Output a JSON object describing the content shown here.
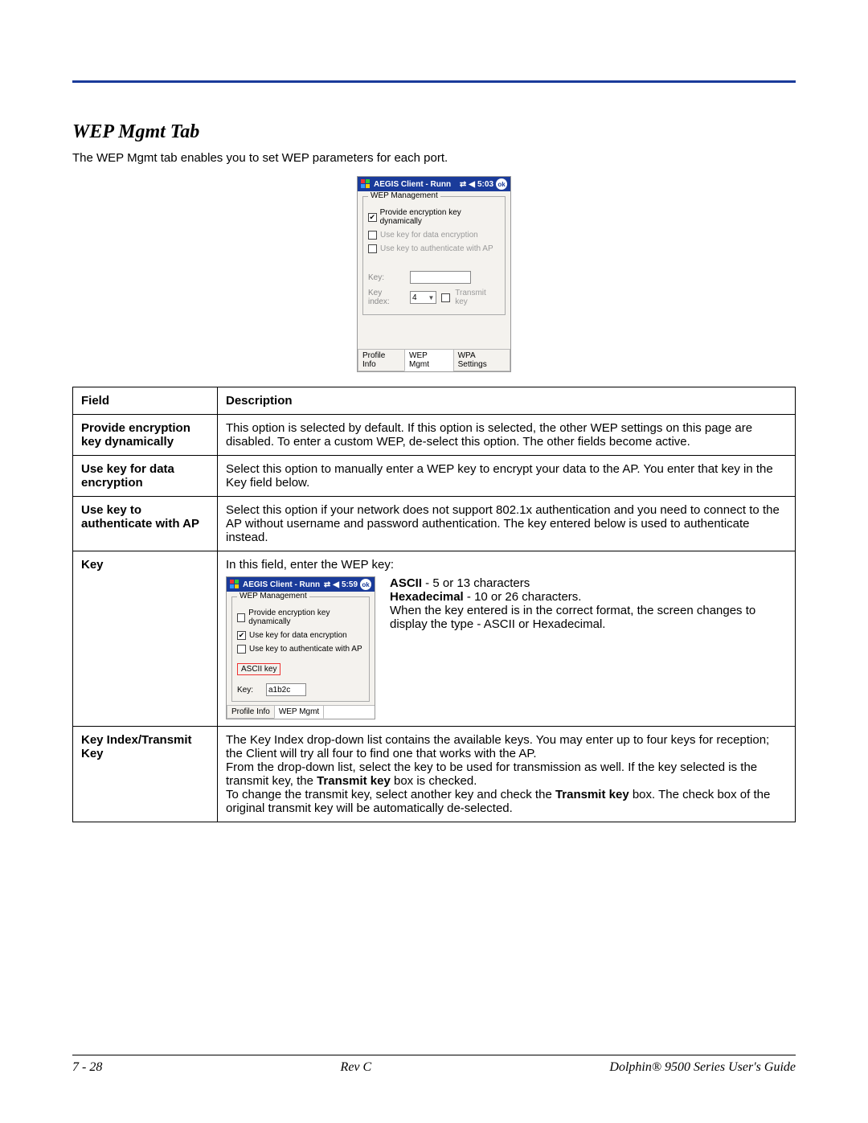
{
  "section_title": "WEP Mgmt Tab",
  "intro": "The WEP Mgmt tab enables you to set WEP parameters for each port.",
  "fig1": {
    "title": "AEGIS Client - Runn",
    "time": "5:03",
    "ok": "ok",
    "group_legend": "WEP Management",
    "chk1": "Provide encryption key dynamically",
    "chk2": "Use key for data encryption",
    "chk3": "Use key to authenticate with AP",
    "key_label": "Key:",
    "keyidx_label": "Key index:",
    "keyidx_value": "4",
    "transmit_label": "Transmit key",
    "tab1": "Profile Info",
    "tab2": "WEP Mgmt",
    "tab3": "WPA Settings"
  },
  "table": {
    "hdr_field": "Field",
    "hdr_desc": "Description",
    "row1_f": "Provide encryption key dynamically",
    "row1_d": "This option is selected by default. If this option is selected, the other WEP settings on this page are disabled. To enter a custom WEP, de-select this option. The other fields become active.",
    "row2_f": "Use key for data encryption",
    "row2_d": "Select this option to manually enter a WEP key to encrypt your data to the AP. You enter that key in the Key field below.",
    "row3_f": "Use key to authenticate with AP",
    "row3_d": "Select this option if your network does not support 802.1x authentication and you need to connect to the AP without username and password authentication. The key entered below is used to authenticate instead.",
    "row4_f": "Key",
    "row4_intro": "In this field, enter the WEP key:",
    "row4_ascii_b": "ASCII",
    "row4_ascii": " - 5 or 13 characters",
    "row4_hex_b": "Hexadecimal",
    "row4_hex": " - 10 or 26 characters.",
    "row4_rest": "When the key entered is in the correct format, the screen changes to display the type - ASCII or Hexadecimal.",
    "row5_f": "Key Index/Transmit Key",
    "row5_p1": "The Key Index drop-down list contains the available keys. You may enter up to four keys for reception; the Client will try all four to find one that works with the AP.",
    "row5_p2a": "From the drop-down list, select the key to be used for transmission as well. If the key selected is the transmit key, the ",
    "row5_p2b": "Transmit key",
    "row5_p2c": " box is checked.",
    "row5_p3a": "To change the transmit key, select another key and check the ",
    "row5_p3b": "Transmit key",
    "row5_p3c": " box. The check box of the original transmit key will be automatically de-selected."
  },
  "fig2": {
    "title": "AEGIS Client - Runn",
    "time": "5:59",
    "ok": "ok",
    "group_legend": "WEP Management",
    "chk1": "Provide encryption key dynamically",
    "chk2": "Use key for data encryption",
    "chk3": "Use key to authenticate with AP",
    "ascii_badge": "ASCII key",
    "key_label": "Key:",
    "key_value": "a1b2c",
    "tab1": "Profile Info",
    "tab2": "WEP Mgmt"
  },
  "footer": {
    "left": "7 - 28",
    "center": "Rev C",
    "right": "Dolphin® 9500 Series User's Guide"
  }
}
